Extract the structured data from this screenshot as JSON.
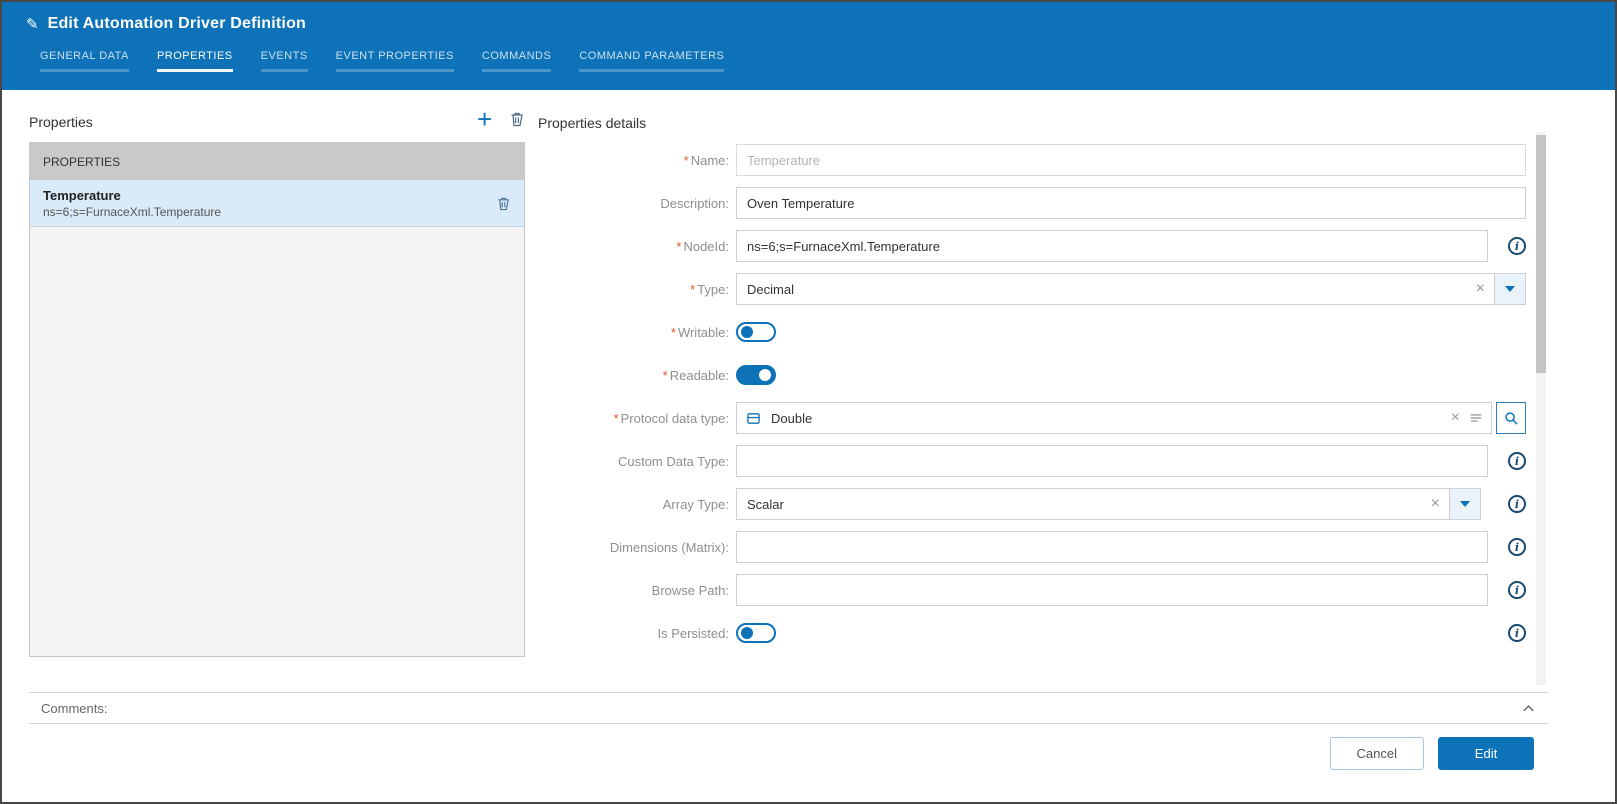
{
  "colors": {
    "accent": "#0d72b8",
    "required_mark": "#e4572e",
    "selection_bg": "#d9eaf8"
  },
  "icons": {
    "edit": "✎",
    "add": "+",
    "clear": "×",
    "info": "i"
  },
  "header": {
    "title": "Edit Automation Driver Definition",
    "tabs": [
      {
        "label": "GENERAL DATA",
        "active": false
      },
      {
        "label": "PROPERTIES",
        "active": true
      },
      {
        "label": "EVENTS",
        "active": false
      },
      {
        "label": "EVENT PROPERTIES",
        "active": false
      },
      {
        "label": "COMMANDS",
        "active": false
      },
      {
        "label": "COMMAND PARAMETERS",
        "active": false
      }
    ]
  },
  "properties_panel": {
    "title": "Properties",
    "list_header": "PROPERTIES",
    "items": [
      {
        "name": "Temperature",
        "node_id": "ns=6;s=FurnaceXml.Temperature",
        "selected": true
      }
    ]
  },
  "details": {
    "title": "Properties details",
    "name": {
      "label": "Name:",
      "required_mark": "*",
      "value": "Temperature",
      "disabled": true
    },
    "description": {
      "label": "Description:",
      "required_mark": "",
      "value": "Oven Temperature"
    },
    "node_id": {
      "label": "NodeId:",
      "required_mark": "*",
      "value": "ns=6;s=FurnaceXml.Temperature"
    },
    "type": {
      "label": "Type:",
      "required_mark": "*",
      "value": "Decimal"
    },
    "writable": {
      "label": "Writable:",
      "required_mark": "*",
      "value": false
    },
    "readable": {
      "label": "Readable:",
      "required_mark": "*",
      "value": true
    },
    "protocol_data_type": {
      "label": "Protocol data type:",
      "required_mark": "*",
      "value": "Double"
    },
    "custom_data_type": {
      "label": "Custom Data Type:",
      "required_mark": "",
      "value": ""
    },
    "array_type": {
      "label": "Array Type:",
      "required_mark": "",
      "value": "Scalar"
    },
    "dimensions_matrix": {
      "label": "Dimensions (Matrix):",
      "required_mark": "",
      "value": ""
    },
    "browse_path": {
      "label": "Browse Path:",
      "required_mark": "",
      "value": ""
    },
    "is_persisted": {
      "label": "Is Persisted:",
      "required_mark": "",
      "value": false
    }
  },
  "comments": {
    "label": "Comments:"
  },
  "footer": {
    "cancel": "Cancel",
    "edit": "Edit"
  }
}
